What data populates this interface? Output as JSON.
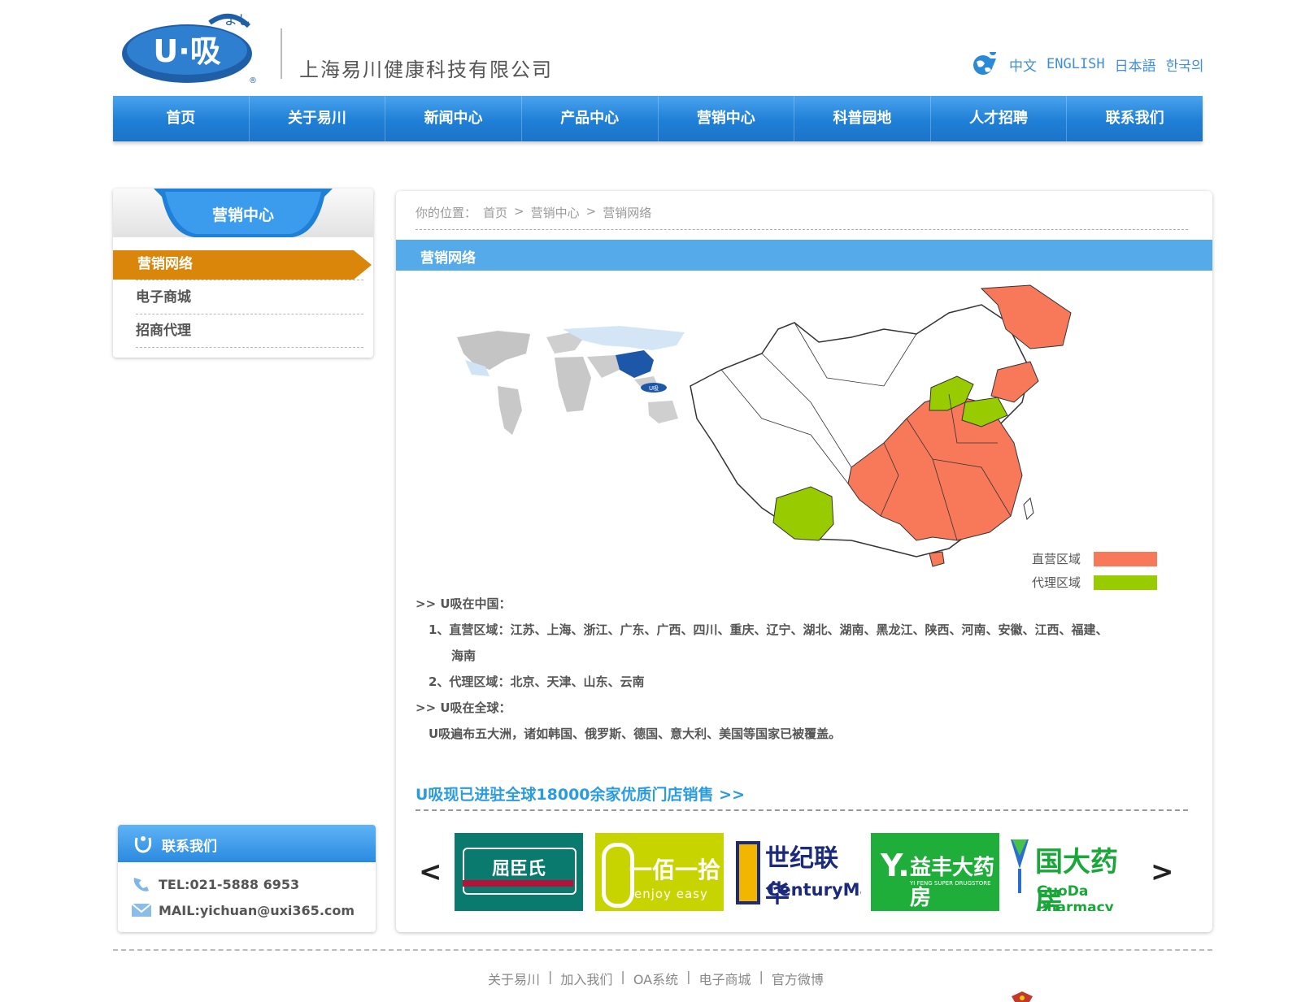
{
  "header": {
    "logo_text": "U·吸",
    "logo_sup": "よし",
    "company": "上海易川健康科技有限公司",
    "languages": [
      "中文",
      "ENGLISH",
      "日本語",
      "한국의"
    ]
  },
  "nav": [
    "首页",
    "关于易川",
    "新闻中心",
    "产品中心",
    "营销中心",
    "科普园地",
    "人才招聘",
    "联系我们"
  ],
  "sidebar": {
    "title": "营销中心",
    "items": [
      "营销网络",
      "电子商城",
      "招商代理"
    ],
    "active": 0
  },
  "contact": {
    "title": "联系我们",
    "tel": "TEL:021-5888 6953",
    "mail": "MAIL:yichuan@uxi365.com"
  },
  "breadcrumb": {
    "label": "你的位置：",
    "items": [
      "首页",
      "营销中心",
      "营销网络"
    ],
    "sep": ">"
  },
  "section_title": "营销网络",
  "legend": [
    {
      "label": "直营区域",
      "color": "#f8785a"
    },
    {
      "label": "代理区域",
      "color": "#99cc00"
    }
  ],
  "content": {
    "china_heading": ">> U吸在中国：",
    "direct_line1": "1、直营区域：江苏、上海、浙江、广东、广西、四川、重庆、辽宁、湖北、湖南、黑龙江、陕西、河南、安徽、江西、福建、",
    "direct_line2": "海南",
    "agent_line": "2、代理区域：北京、天津、山东、云南",
    "global_heading": ">> U吸在全球：",
    "global_text": "U吸遍布五大洲，诸如韩国、俄罗斯、德国、意大利、美国等国家已被覆盖。",
    "promo": "U吸现已进驻全球18000余家优质门店销售 >>"
  },
  "brands": [
    {
      "name": "屈臣氏",
      "sub": "",
      "bg": "#0b7a6e"
    },
    {
      "name": "一佰一拾",
      "sub": "enjoy easy",
      "bg": "#c8d400"
    },
    {
      "name": "世纪联华",
      "sub": "CenturyMart",
      "bg": "#ffffff"
    },
    {
      "name": "益丰大药房",
      "sub": "YI FENG SUPER DRUGSTORE",
      "bg": "#1fae3a"
    },
    {
      "name": "国大药房",
      "sub": "GuoDa Pharmacy",
      "bg": "#ffffff"
    }
  ],
  "carousel": {
    "prev": "<",
    "next": ">"
  },
  "footer": [
    "关于易川",
    "加入我们",
    "OA系统",
    "电子商城",
    "官方微博"
  ],
  "footer_sep": "|",
  "colors": {
    "nav_blue": "#1f7fd6",
    "active_orange": "#d9860a",
    "accent_blue": "#2b9be0"
  }
}
